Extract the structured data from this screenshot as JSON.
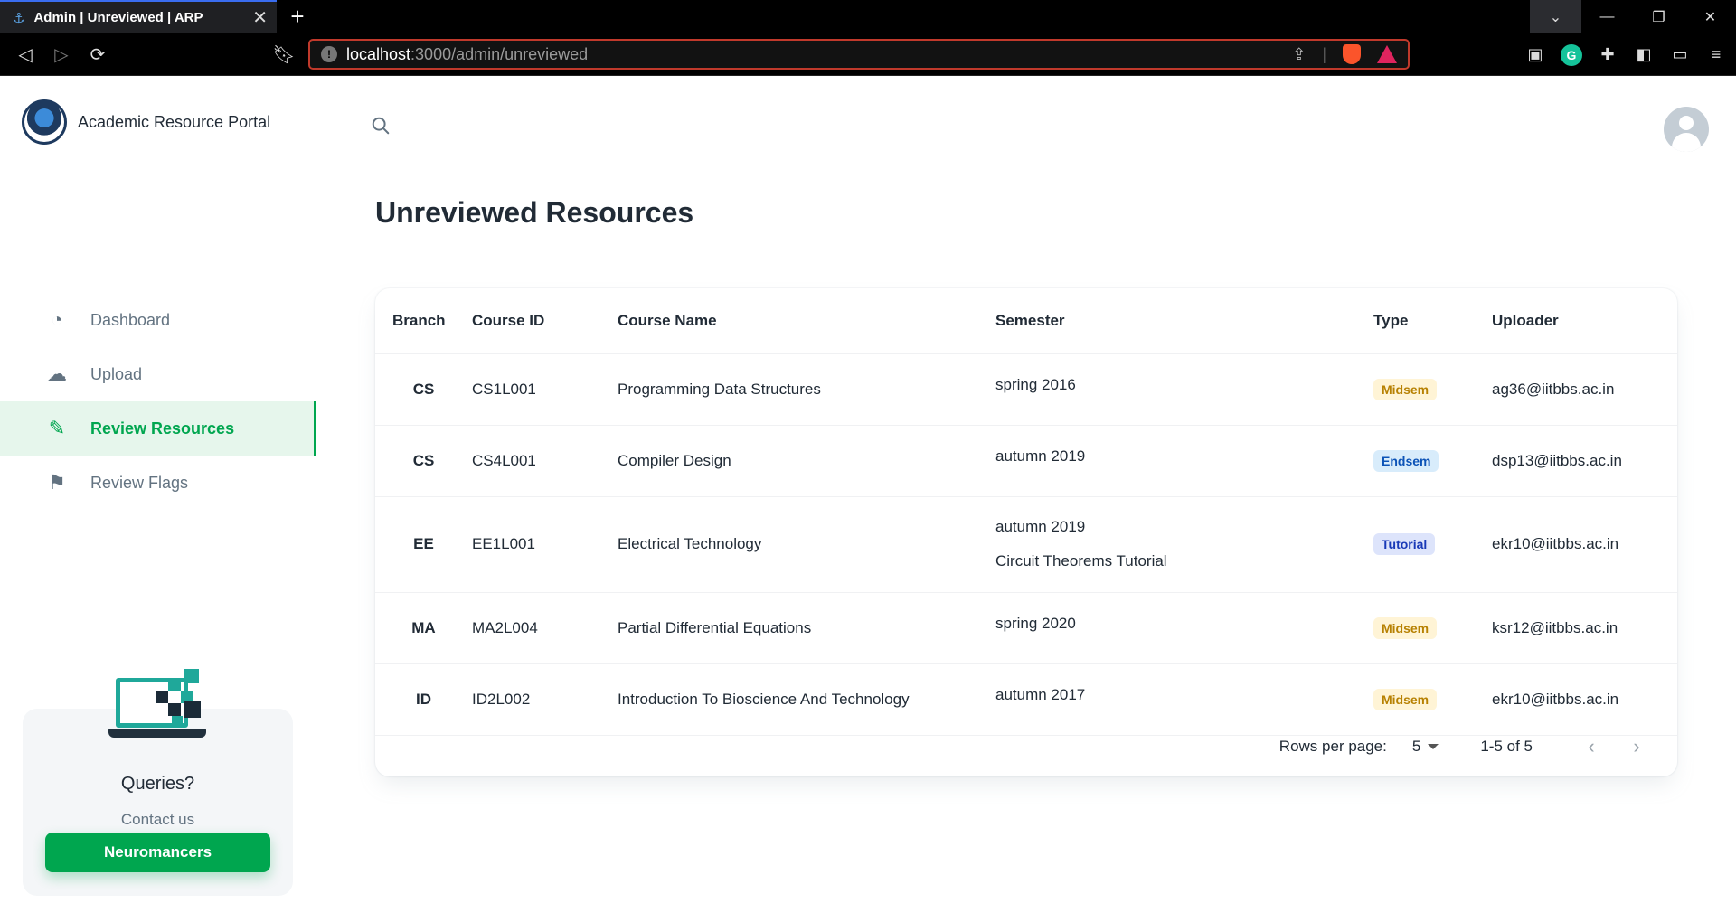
{
  "browser": {
    "tab_title": "Admin | Unreviewed | ARP",
    "url_host": "localhost",
    "url_path": ":3000/admin/unreviewed"
  },
  "sidebar": {
    "brand": "Academic Resource Portal",
    "items": [
      {
        "label": "Dashboard",
        "icon": "pie-chart-icon",
        "active": false
      },
      {
        "label": "Upload",
        "icon": "cloud-upload-icon",
        "active": false
      },
      {
        "label": "Review Resources",
        "icon": "review-icon",
        "active": true
      },
      {
        "label": "Review Flags",
        "icon": "flag-icon",
        "active": false
      }
    ],
    "query": {
      "title": "Queries?",
      "subtitle": "Contact us",
      "button": "Neuromancers"
    }
  },
  "main": {
    "title": "Unreviewed Resources",
    "table": {
      "columns": [
        "Branch",
        "Course ID",
        "Course Name",
        "Semester",
        "Type",
        "Uploader"
      ],
      "rows": [
        {
          "branch": "CS",
          "course_id": "CS1L001",
          "course_name": "Programming Data Structures",
          "semester": "spring 2016",
          "semester_note": "",
          "type": "Midsem",
          "uploader": "ag36@iitbbs.ac.in"
        },
        {
          "branch": "CS",
          "course_id": "CS4L001",
          "course_name": "Compiler Design",
          "semester": "autumn 2019",
          "semester_note": "",
          "type": "Endsem",
          "uploader": "dsp13@iitbbs.ac.in"
        },
        {
          "branch": "EE",
          "course_id": "EE1L001",
          "course_name": "Electrical Technology",
          "semester": "autumn 2019",
          "semester_note": "Circuit Theorems Tutorial",
          "type": "Tutorial",
          "uploader": "ekr10@iitbbs.ac.in"
        },
        {
          "branch": "MA",
          "course_id": "MA2L004",
          "course_name": "Partial Differential Equations",
          "semester": "spring 2020",
          "semester_note": "",
          "type": "Midsem",
          "uploader": "ksr12@iitbbs.ac.in"
        },
        {
          "branch": "ID",
          "course_id": "ID2L002",
          "course_name": "Introduction To Bioscience And Technology",
          "semester": "autumn 2017",
          "semester_note": "",
          "type": "Midsem",
          "uploader": "ekr10@iitbbs.ac.in"
        }
      ]
    },
    "badge_colors": {
      "Midsem": {
        "bg": "#fff4d6",
        "fg": "#b78103"
      },
      "Endsem": {
        "bg": "#d8ecfb",
        "fg": "#0c53b7"
      },
      "Tutorial": {
        "bg": "#dde4fb",
        "fg": "#1939b7"
      }
    },
    "pagination": {
      "rows_per_page_label": "Rows per page:",
      "rows_per_page": "5",
      "range": "1-5 of 5"
    }
  }
}
